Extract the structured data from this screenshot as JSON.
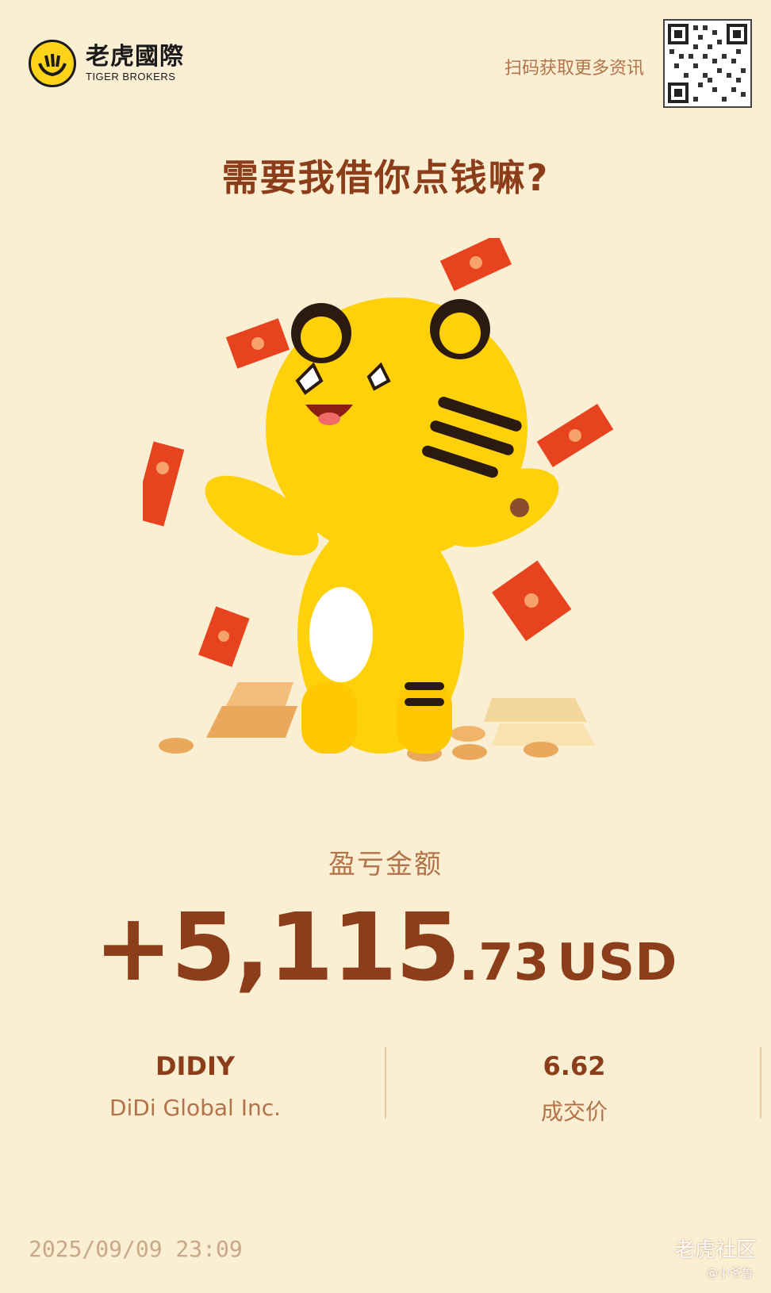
{
  "brand": {
    "name_cn": "老虎國際",
    "name_en": "TIGER BROKERS"
  },
  "header": {
    "scan_text": "扫码获取更多资讯"
  },
  "headline": "需要我借你点钱嘛?",
  "pnl": {
    "label": "盈亏金额",
    "sign": "+",
    "integer": "5,115",
    "decimal": ".73",
    "currency": "USD"
  },
  "stock": {
    "ticker": "DIDIY",
    "company": "DiDi Global Inc."
  },
  "trade": {
    "price": "6.62",
    "price_label": "成交价"
  },
  "footer": {
    "timestamp": "2025/09/09 23:09",
    "watermark": "老虎社区",
    "watermark_user": "@小爷鲁"
  },
  "colors": {
    "background": "#FBEFD3",
    "primary_text": "#8C3E1A",
    "secondary_text": "#B3734A",
    "tiger_yellow": "#FFD21A",
    "red_envelope": "#E8431F"
  },
  "icons": [
    "tiger-logo-icon",
    "qr-code-icon",
    "tiger-mascot-illustration"
  ]
}
